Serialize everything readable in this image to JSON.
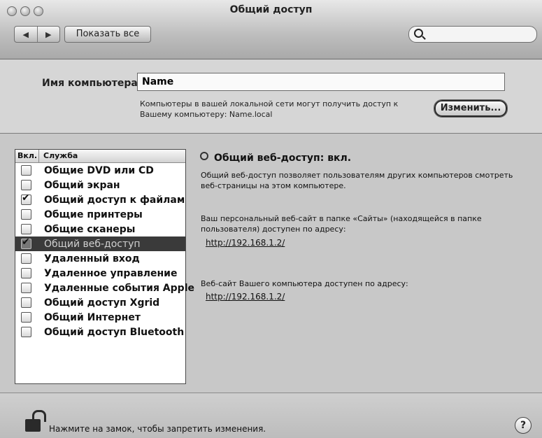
{
  "window": {
    "title": "Общий доступ"
  },
  "toolbar": {
    "back_label": "◀",
    "forward_label": "▶",
    "show_all_label": "Показать все",
    "search_value": "",
    "search_icon": "search-icon"
  },
  "computer": {
    "name_label": "Имя компьютера:",
    "name_value": "Name",
    "hint": "Компьютеры в вашей локальной сети могут получить доступ к Вашему компьютеру: Name.local",
    "change_label": "Изменить..."
  },
  "services": {
    "header_on": "Вкл.",
    "header_service": "Служба",
    "items": [
      {
        "label": "Общие DVD или CD",
        "checked": false,
        "selected": false
      },
      {
        "label": "Общий экран",
        "checked": false,
        "selected": false
      },
      {
        "label": "Общий доступ к файлам",
        "checked": true,
        "selected": false
      },
      {
        "label": "Общие принтеры",
        "checked": false,
        "selected": false
      },
      {
        "label": "Общие сканеры",
        "checked": false,
        "selected": false
      },
      {
        "label": "Общий веб-доступ",
        "checked": true,
        "selected": true
      },
      {
        "label": "Удаленный вход",
        "checked": false,
        "selected": false
      },
      {
        "label": "Удаленное управление",
        "checked": false,
        "selected": false
      },
      {
        "label": "Удаленные события Apple",
        "checked": false,
        "selected": false
      },
      {
        "label": "Общий доступ Xgrid",
        "checked": false,
        "selected": false
      },
      {
        "label": "Общий Интернет",
        "checked": false,
        "selected": false
      },
      {
        "label": "Общий доступ Bluetooth",
        "checked": false,
        "selected": false
      }
    ]
  },
  "detail": {
    "status": "Общий веб-доступ: вкл.",
    "description": "Общий веб-доступ позволяет пользователям других компьютеров смотреть веб-страницы на этом компьютере.",
    "personal_site_text": "Ваш персональный веб-сайт в папке «Сайты» (находящейся в папке пользователя) доступен по адресу:",
    "personal_site_url": "http://192.168.1.2/",
    "computer_site_text": "Веб-сайт Вашего компьютера доступен по адресу:",
    "computer_site_url": "http://192.168.1.2/"
  },
  "footer": {
    "lock_text": "Нажмите на замок, чтобы запретить изменения.",
    "help_label": "?"
  }
}
